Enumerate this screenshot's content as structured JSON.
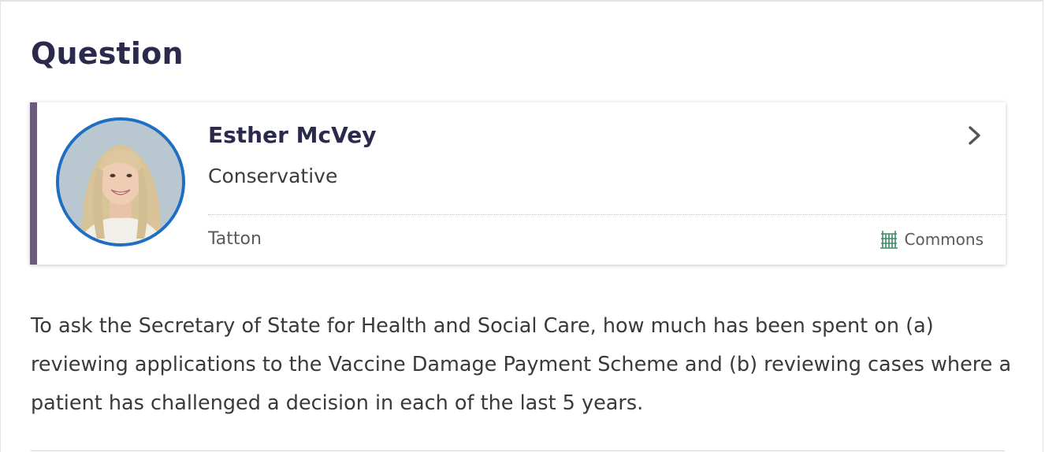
{
  "section": {
    "heading": "Question"
  },
  "member": {
    "name": "Esther McVey",
    "party": "Conservative",
    "constituency": "Tatton",
    "house": "Commons",
    "accent_color": "#6b5a7a",
    "avatar_ring_color": "#1e6fc2",
    "house_icon": "portcullis-icon"
  },
  "question": {
    "text": "To ask the Secretary of State for Health and Social Care, how much has been spent on (a) reviewing applications to the Vaccine Damage Payment Scheme and (b) reviewing cases where a patient has challenged a decision in each of the last 5 years."
  }
}
